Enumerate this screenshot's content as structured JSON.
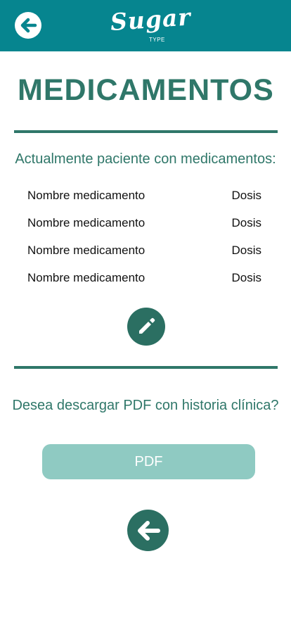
{
  "header": {
    "logo_text": "Sugar",
    "logo_subtext": "TYPE",
    "back_icon": "arrow-left-icon"
  },
  "page": {
    "title": "MEDICAMENTOS"
  },
  "medications": {
    "heading": "Actualmente paciente con medicamentos:",
    "items": [
      {
        "name": "Nombre medicamento",
        "dose": "Dosis"
      },
      {
        "name": "Nombre medicamento",
        "dose": "Dosis"
      },
      {
        "name": "Nombre medicamento",
        "dose": "Dosis"
      },
      {
        "name": "Nombre medicamento",
        "dose": "Dosis"
      }
    ],
    "edit_icon": "pencil-icon"
  },
  "pdf": {
    "question": "Desea descargar PDF con historia clínica?",
    "button_label": "PDF"
  },
  "footer": {
    "back_icon": "arrow-left-icon"
  },
  "colors": {
    "header_bg": "#06858f",
    "primary_green": "#2f7769",
    "button_dark": "#2b6f62",
    "pdf_button_bg": "#8fcac2"
  }
}
